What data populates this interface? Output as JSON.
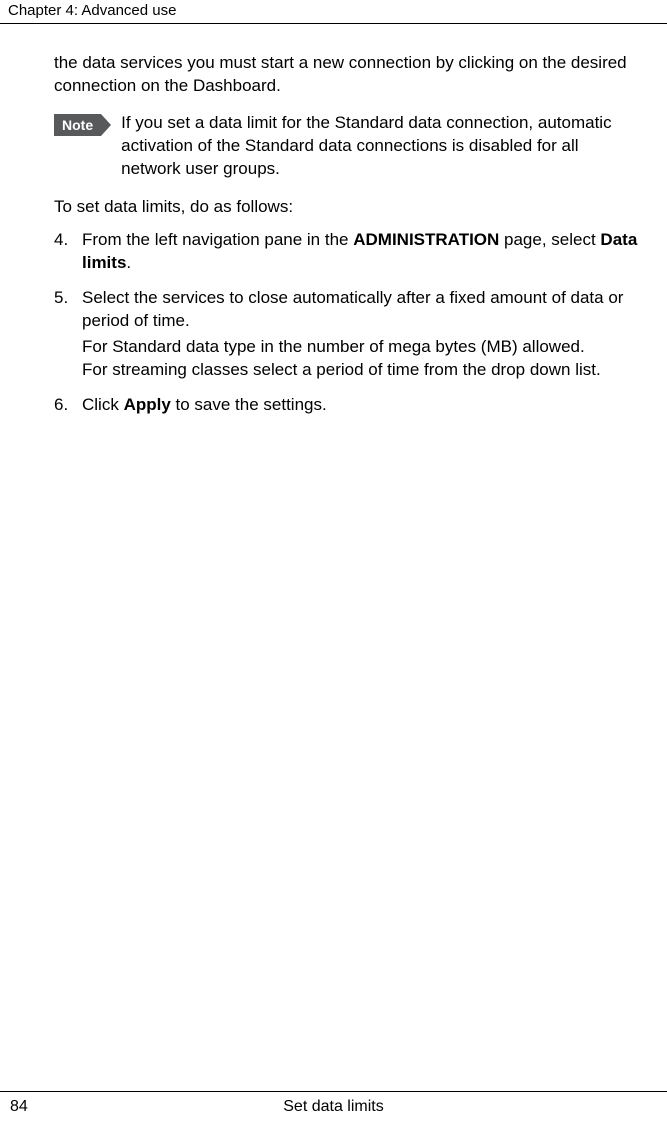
{
  "header": {
    "chapter": "Chapter 4:  Advanced use"
  },
  "intro": "the data services you must start a new connection by clicking on the desired connection on the Dashboard.",
  "note": {
    "label": "Note",
    "text": "If you set a data limit for the Standard data connection, automatic activation of the Standard data connections is disabled for all network user groups."
  },
  "lead": "To set data limits, do as follows:",
  "steps": [
    {
      "num": "4.",
      "pre": "From the left navigation pane in the ",
      "bold1": "ADMINISTRATION",
      "mid": " page, select ",
      "bold2": "Data limits",
      "post": "."
    },
    {
      "num": "5.",
      "text": "Select the services to close automatically after a fixed amount of data or period of time.",
      "sub1": "For Standard data type in the number of mega bytes (MB) allowed.",
      "sub2": "For streaming classes select a period of time from the drop down list."
    },
    {
      "num": "6.",
      "pre": "Click ",
      "bold1": "Apply",
      "post": " to save the settings."
    }
  ],
  "footer": {
    "page": "84",
    "title": "Set data limits"
  }
}
